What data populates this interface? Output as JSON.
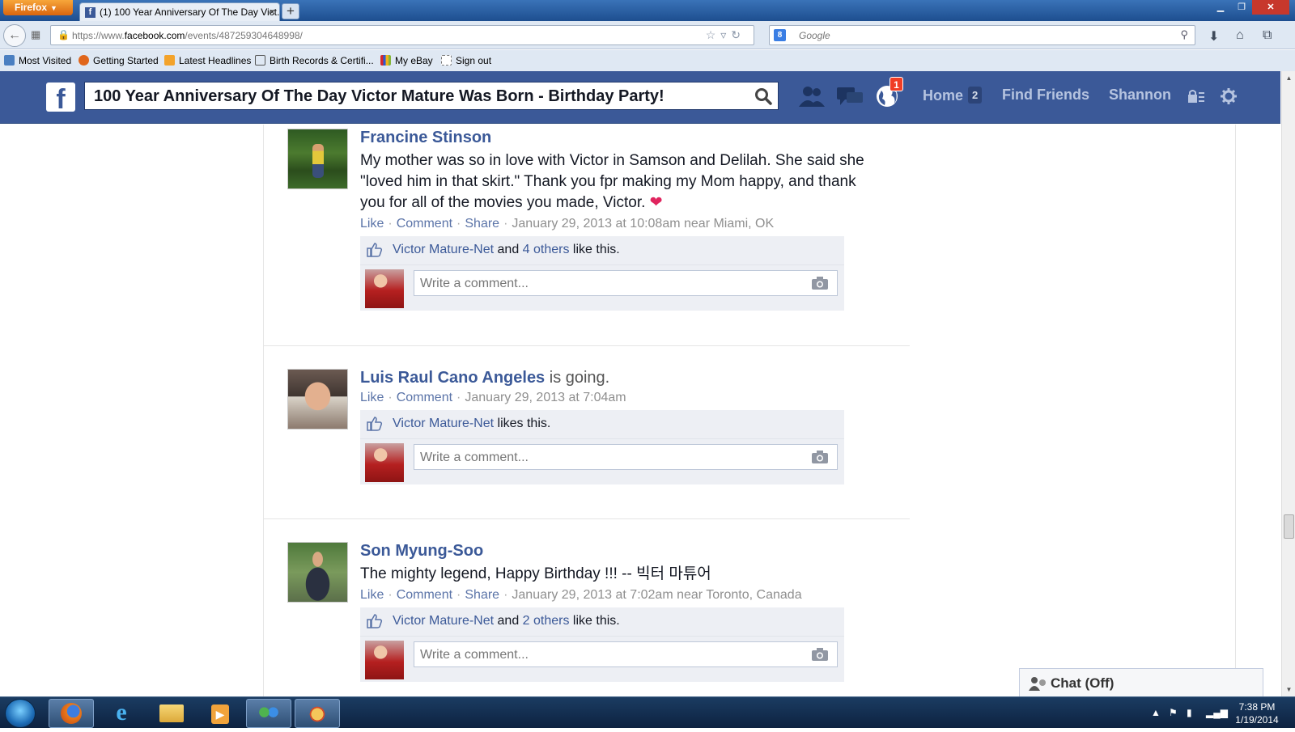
{
  "browser": {
    "firefox_menu": "Firefox",
    "tab_title": "(1) 100 Year Anniversary Of The Day Vict...",
    "url_prefix": "https://www.",
    "url_domain": "facebook.com",
    "url_path": "/events/487259304648998/",
    "search_placeholder": "Google",
    "bookmarks": [
      {
        "label": "Most Visited",
        "icon_color": "#4a7fc1"
      },
      {
        "label": "Getting Started",
        "icon_color": "#e0661c"
      },
      {
        "label": "Latest Headlines",
        "icon_color": "#f3a32b"
      },
      {
        "label": "Birth Records & Certifi...",
        "icon_color": "#555555"
      },
      {
        "label": "My eBay",
        "icon_color": "#d6282e"
      },
      {
        "label": "Sign out",
        "icon_color": "#ffffff"
      }
    ]
  },
  "fb": {
    "brand_color": "#3b5998",
    "search_value": "100 Year Anniversary Of The Day Victor Mature Was Born - Birthday Party!",
    "notifications_count": "1",
    "nav_home": "Home",
    "nav_home_count": "2",
    "nav_find_friends": "Find Friends",
    "nav_user": "Shannon"
  },
  "posts": [
    {
      "author": "Francine Stinson",
      "author_suffix": "",
      "text": "My mother was so in love with Victor in Samson and Delilah. She said she \"loved him in that skirt.\" Thank you fpr making my Mom happy, and thank you for all of the movies you made, Victor. ❤",
      "actions": [
        "Like",
        "Comment",
        "Share"
      ],
      "timestamp": "January 29, 2013 at 10:08am near Miami, OK",
      "likes_name": "Victor Mature-Net",
      "likes_mid": " and ",
      "likes_others": "4 others",
      "likes_end": " like this.",
      "comment_placeholder": "Write a comment..."
    },
    {
      "author": "Luis Raul Cano Angeles",
      "author_suffix": " is going.",
      "text": "",
      "actions": [
        "Like",
        "Comment"
      ],
      "timestamp": "January 29, 2013 at 7:04am",
      "likes_name": "Victor Mature-Net",
      "likes_mid": " likes this.",
      "likes_others": "",
      "likes_end": "",
      "comment_placeholder": "Write a comment..."
    },
    {
      "author": "Son Myung-Soo",
      "author_suffix": "",
      "text": "The mighty legend, Happy Birthday !!! -- 빅터 마튜어",
      "actions": [
        "Like",
        "Comment",
        "Share"
      ],
      "timestamp": "January 29, 2013 at 7:02am near Toronto, Canada",
      "likes_name": "Victor Mature-Net",
      "likes_mid": " and ",
      "likes_others": "2 others",
      "likes_end": " like this.",
      "comment_placeholder": "Write a comment..."
    }
  ],
  "chat": {
    "label": "Chat (Off)"
  },
  "taskbar": {
    "time": "7:38 PM",
    "date": "1/19/2014"
  }
}
